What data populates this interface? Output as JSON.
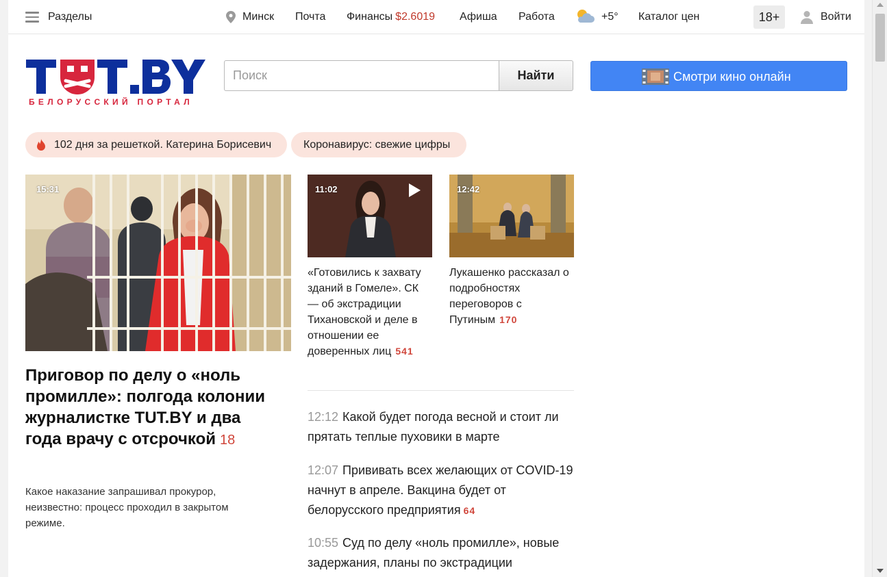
{
  "topbar": {
    "sections": "Разделы",
    "city": "Минск",
    "mail": "Почта",
    "finance_label": "Финансы",
    "finance_rate": "$2.6019",
    "afisha": "Афиша",
    "work": "Работа",
    "temperature": "+5°",
    "catalog": "Каталог цен",
    "age_rating": "18+",
    "login": "Войти"
  },
  "logo": {
    "wordmark": "TUT.BY",
    "tagline": "БЕЛОРУССКИЙ ПОРТАЛ"
  },
  "search": {
    "placeholder": "Поиск",
    "button": "Найти"
  },
  "cinema_button": "Смотри кино онлайн",
  "tags": [
    {
      "label": "102 дня за решеткой. Катерина Борисевич",
      "icon": "flame-icon"
    },
    {
      "label": "Коронавирус: свежие цифры"
    }
  ],
  "lead": {
    "time": "15:31",
    "title": "Приговор по делу о «ноль промилле»: полгода колонии журналистке TUT.BY и два года врачу с отсрочкой",
    "comments": "18",
    "summary": "Какое наказание запрашивал прокурор, неизвестно: процесс проходил в закрытом режиме."
  },
  "cards": [
    {
      "time": "11:02",
      "video": true,
      "title": "«Готовились к захвату зданий в Гомеле». СК — об экстрадиции Тихановской и деле в отношении ее доверенных лиц",
      "comments": "541"
    },
    {
      "time": "12:42",
      "video": false,
      "title": "Лукашенко рассказал о подробностях переговоров с Путиным",
      "comments": "170"
    }
  ],
  "news": [
    {
      "time": "12:12",
      "title": "Какой будет погода весной и стоит ли прятать теплые пуховики в марте",
      "comments": ""
    },
    {
      "time": "12:07",
      "title": "Прививать всех желающих от COVID-19 начнут в апреле. Вакцина будет от белорусского предприятия",
      "comments": "64"
    },
    {
      "time": "10:55",
      "title": "Суд по делу «ноль промилле», новые задержания, планы по экстрадиции Тихановской. Что ... главное",
      "comments": ""
    }
  ],
  "colors": {
    "brand_blue": "#0d2f9c",
    "brand_red": "#d7263d",
    "cinema_blue": "#4285f4",
    "count_red": "#d0463b",
    "pill_bg": "#fbe4dd"
  }
}
